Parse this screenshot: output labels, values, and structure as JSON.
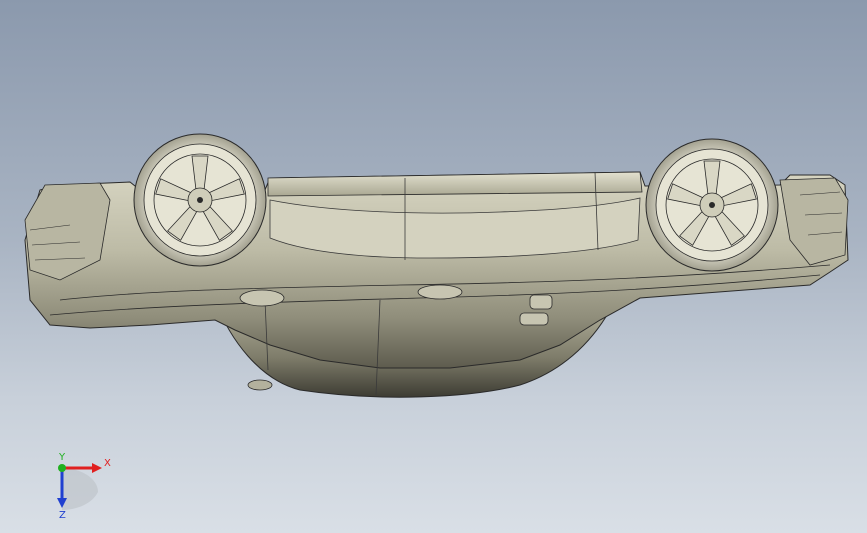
{
  "viewport": {
    "background_top": "#8b99ad",
    "background_bottom": "#d9dfe6"
  },
  "model": {
    "body_color": "#c9c7b3",
    "edge_color": "#2a2a2a"
  },
  "triad": {
    "x_label": "X",
    "y_label": "Y",
    "z_label": "Z",
    "x_color": "#e02020",
    "y_color": "#20b020",
    "z_color": "#2040d0"
  }
}
